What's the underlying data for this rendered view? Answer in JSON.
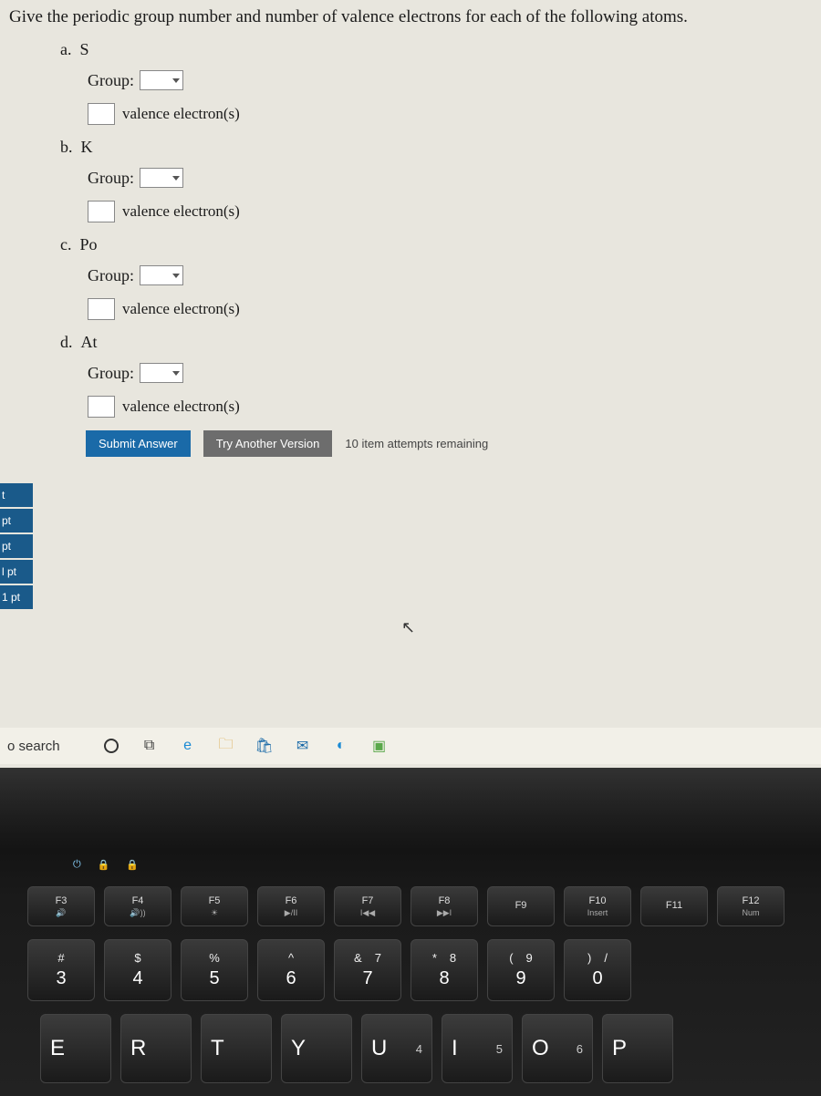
{
  "prompt": "Give the periodic group number and number of valence electrons for each of the following atoms.",
  "items": [
    {
      "letter": "a.",
      "symbol": "S"
    },
    {
      "letter": "b.",
      "symbol": "K"
    },
    {
      "letter": "c.",
      "symbol": "Po"
    },
    {
      "letter": "d.",
      "symbol": "At"
    }
  ],
  "labels": {
    "group": "Group:",
    "valence": "valence electron(s)"
  },
  "buttons": {
    "submit": "Submit Answer",
    "try": "Try Another Version"
  },
  "attempts": "10 item attempts remaining",
  "sidebar": [
    "t",
    "pt",
    "pt",
    "l pt",
    "1 pt"
  ],
  "search": "o search",
  "keyboard": {
    "leds": [
      "⏻",
      "🔒",
      "🔒"
    ],
    "fn": [
      {
        "label": "F3",
        "sub": "🔊"
      },
      {
        "label": "F4",
        "sub": "🔊))"
      },
      {
        "label": "F5",
        "sub": "☀"
      },
      {
        "label": "F6",
        "sub": "▶/II"
      },
      {
        "label": "F7",
        "sub": "I◀◀"
      },
      {
        "label": "F8",
        "sub": "▶▶I"
      },
      {
        "label": "F9",
        "sub": ""
      },
      {
        "label": "F10",
        "sub": "Insert"
      },
      {
        "label": "F11",
        "sub": ""
      },
      {
        "label": "F12",
        "sub": "Num"
      }
    ],
    "num": [
      {
        "sym": "#",
        "alt": "",
        "num": "3"
      },
      {
        "sym": "$",
        "alt": "",
        "num": "4"
      },
      {
        "sym": "%",
        "alt": "",
        "num": "5"
      },
      {
        "sym": "^",
        "alt": "",
        "num": "6"
      },
      {
        "sym": "&",
        "alt": "7",
        "num": "7"
      },
      {
        "sym": "*",
        "alt": "8",
        "num": "8"
      },
      {
        "sym": "(",
        "alt": "9",
        "num": "9"
      },
      {
        "sym": ")",
        "alt": "/",
        "num": "0"
      }
    ],
    "letters": [
      {
        "big": "E",
        "small": ""
      },
      {
        "big": "R",
        "small": ""
      },
      {
        "big": "T",
        "small": ""
      },
      {
        "big": "Y",
        "small": ""
      },
      {
        "big": "U",
        "small": "4"
      },
      {
        "big": "I",
        "small": "5"
      },
      {
        "big": "O",
        "small": "6"
      },
      {
        "big": "P",
        "small": ""
      }
    ]
  }
}
